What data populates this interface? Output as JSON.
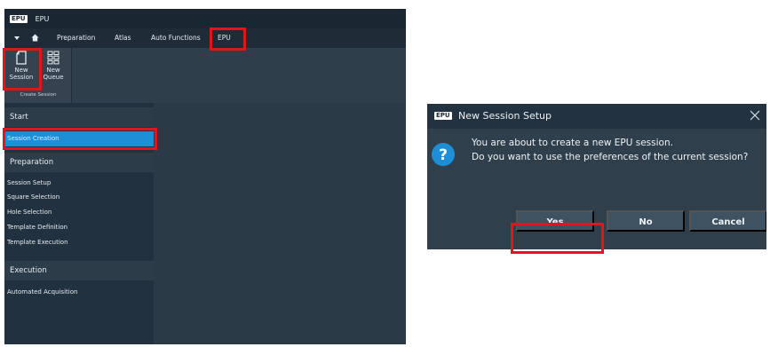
{
  "window": {
    "logo": "EPU",
    "title": "EPU"
  },
  "menubar": {
    "items": [
      "Preparation",
      "Atlas",
      "Auto Functions",
      "EPU"
    ]
  },
  "ribbon": {
    "new_session": [
      "New",
      "Session"
    ],
    "new_queue": [
      "New",
      "Queue"
    ],
    "group_label": "Create Session"
  },
  "sidebar": {
    "sections": [
      {
        "header": "Start",
        "items": [
          "Session Creation"
        ]
      },
      {
        "header": "Preparation",
        "items": [
          "Session Setup",
          "Square Selection",
          "Hole Selection",
          "Template Definition",
          "Template Execution"
        ]
      },
      {
        "header": "Execution",
        "items": [
          "Automated Acquisition"
        ]
      }
    ],
    "selected": "Session Creation"
  },
  "dialog": {
    "logo": "EPU",
    "title": "New Session Setup",
    "message_line1": "You are about to create a new EPU session.",
    "message_line2": "Do you want to use the preferences of the current session?",
    "buttons": {
      "yes": "Yes",
      "no": "No",
      "cancel": "Cancel"
    }
  },
  "colors": {
    "highlight": "#e0161d",
    "selected": "#1e8fd6",
    "app_background": "#2b3a47",
    "question_icon": "#1e8fd6"
  }
}
